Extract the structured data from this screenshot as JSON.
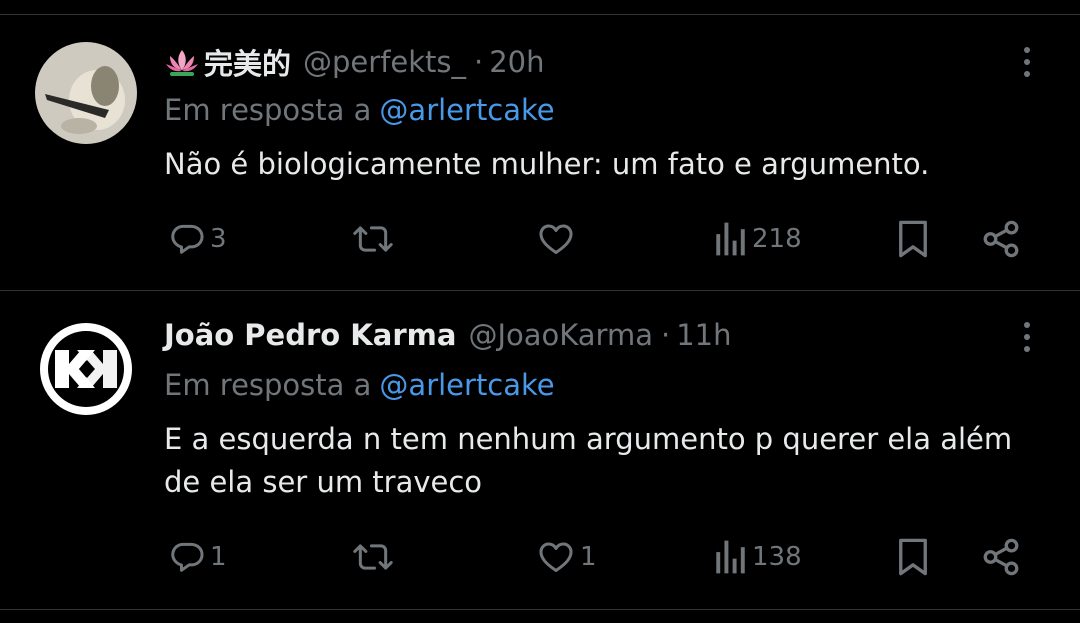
{
  "tweets": [
    {
      "display_name": "完美的",
      "name_emoji": "lotus-icon",
      "handle": "@perfekts_",
      "separator": "·",
      "time": "20h",
      "reply_prefix": "Em resposta a",
      "reply_to": "@arlertcake",
      "text": "Não é biologicamente mulher: um fato e argumento.",
      "actions": {
        "replies": "3",
        "retweets": "",
        "likes": "",
        "views": "218"
      }
    },
    {
      "display_name": "João Pedro Karma",
      "handle": "@JoaoKarma",
      "separator": "·",
      "time": "11h",
      "reply_prefix": "Em resposta a",
      "reply_to": "@arlertcake",
      "text": "E a esquerda n tem nenhum argumento p querer ela além de ela ser um traveco",
      "actions": {
        "replies": "1",
        "retweets": "",
        "likes": "1",
        "views": "138"
      }
    }
  ],
  "colors": {
    "background": "#000000",
    "text": "#e7e9ea",
    "muted": "#71767b",
    "link": "#4a99e9",
    "divider": "#2f3336"
  }
}
